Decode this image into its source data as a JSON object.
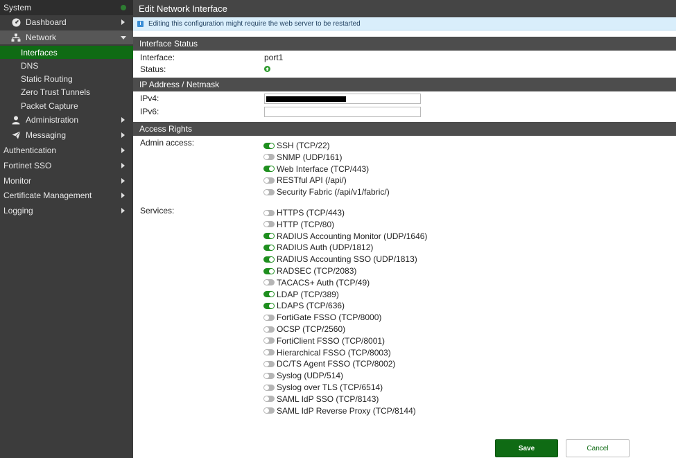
{
  "sidebar": {
    "system": "System",
    "dashboard": "Dashboard",
    "network": "Network",
    "network_children": [
      "Interfaces",
      "DNS",
      "Static Routing",
      "Zero Trust Tunnels",
      "Packet Capture"
    ],
    "administration": "Administration",
    "messaging": "Messaging",
    "top_items": [
      "Authentication",
      "Fortinet SSO",
      "Monitor",
      "Certificate Management",
      "Logging"
    ]
  },
  "page": {
    "title": "Edit Network Interface",
    "notice": "Editing this configuration might require the web server to be restarted"
  },
  "interface_status": {
    "header": "Interface Status",
    "interface_label": "Interface:",
    "interface_value": "port1",
    "status_label": "Status:"
  },
  "ip": {
    "header": "IP Address / Netmask",
    "ipv4_label": "IPv4:",
    "ipv6_label": "IPv6:",
    "ipv6_value": ""
  },
  "access": {
    "header": "Access Rights",
    "admin_label": "Admin access:",
    "admin": [
      {
        "label": "SSH (TCP/22)",
        "on": true
      },
      {
        "label": "SNMP (UDP/161)",
        "on": false
      },
      {
        "label": "Web Interface (TCP/443)",
        "on": true
      },
      {
        "label": "RESTful API (/api/)",
        "on": false
      },
      {
        "label": "Security Fabric (/api/v1/fabric/)",
        "on": false
      }
    ],
    "services_label": "Services:",
    "services": [
      {
        "label": "HTTPS (TCP/443)",
        "on": false
      },
      {
        "label": "HTTP (TCP/80)",
        "on": false
      },
      {
        "label": "RADIUS Accounting Monitor (UDP/1646)",
        "on": true
      },
      {
        "label": "RADIUS Auth (UDP/1812)",
        "on": true
      },
      {
        "label": "RADIUS Accounting SSO (UDP/1813)",
        "on": true
      },
      {
        "label": "RADSEC (TCP/2083)",
        "on": true
      },
      {
        "label": "TACACS+ Auth (TCP/49)",
        "on": false
      },
      {
        "label": "LDAP (TCP/389)",
        "on": true
      },
      {
        "label": "LDAPS (TCP/636)",
        "on": true
      },
      {
        "label": "FortiGate FSSO (TCP/8000)",
        "on": false
      },
      {
        "label": "OCSP (TCP/2560)",
        "on": false
      },
      {
        "label": "FortiClient FSSO (TCP/8001)",
        "on": false
      },
      {
        "label": "Hierarchical FSSO (TCP/8003)",
        "on": false
      },
      {
        "label": "DC/TS Agent FSSO (TCP/8002)",
        "on": false
      },
      {
        "label": "Syslog (UDP/514)",
        "on": false
      },
      {
        "label": "Syslog over TLS (TCP/6514)",
        "on": false
      },
      {
        "label": "SAML IdP SSO (TCP/8143)",
        "on": false
      },
      {
        "label": "SAML IdP Reverse Proxy (TCP/8144)",
        "on": false
      }
    ]
  },
  "buttons": {
    "save": "Save",
    "cancel": "Cancel"
  },
  "colors": {
    "accent": "#0f6b14",
    "toggle_on": "#1f8f1f",
    "toggle_off": "#b5b5b5"
  }
}
